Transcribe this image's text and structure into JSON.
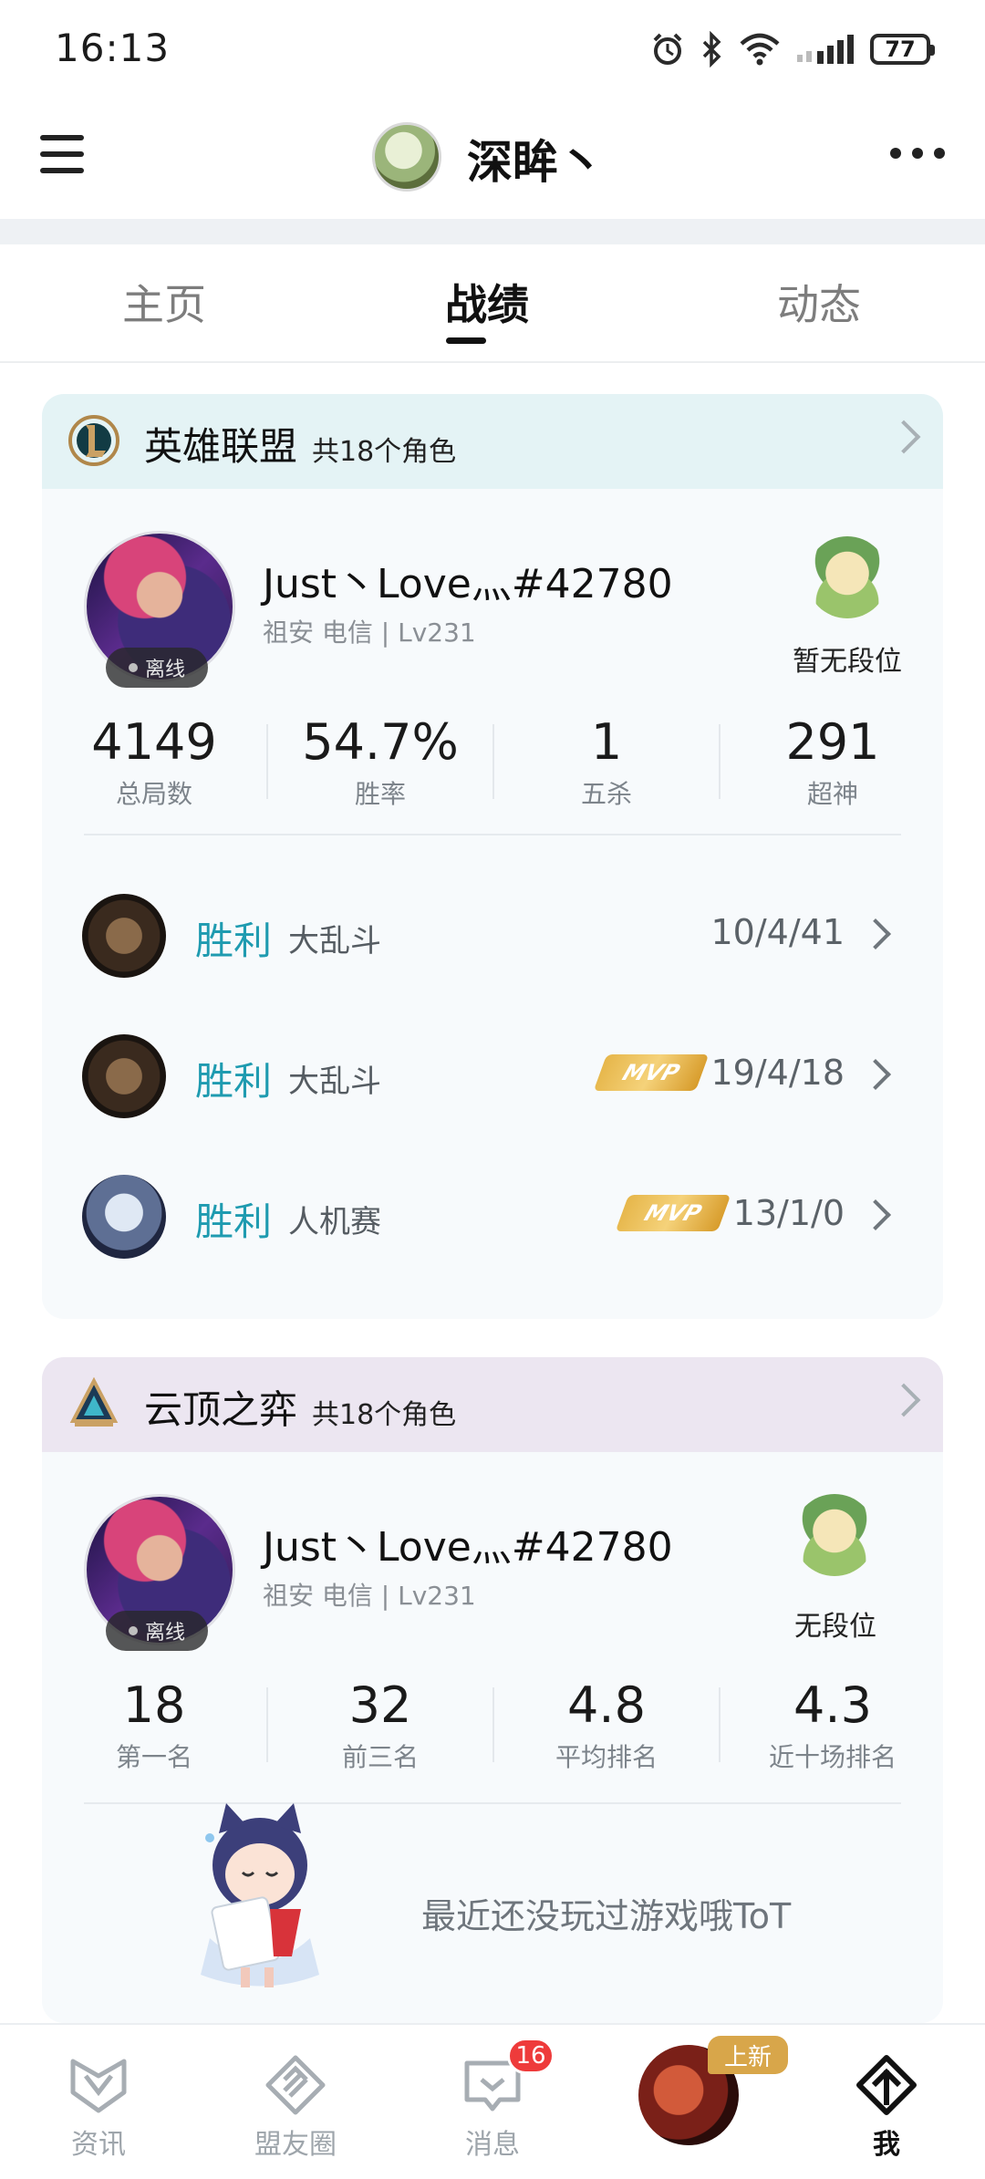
{
  "status_bar": {
    "time": "16:13",
    "battery": "77",
    "icons": [
      "alarm-icon",
      "bluetooth-icon",
      "wifi-icon",
      "signal-icon",
      "battery-icon"
    ]
  },
  "header": {
    "title": "深眸丶",
    "menu_icon": "menu-icon",
    "more_icon": "more-icon"
  },
  "tabs": [
    {
      "label": "主页",
      "active": false
    },
    {
      "label": "战绩",
      "active": true
    },
    {
      "label": "动态",
      "active": false
    }
  ],
  "lol_card": {
    "title": "英雄联盟",
    "count": "共18个角色",
    "account_name": "Just丶Love灬#42780",
    "account_meta": "祖安 电信 | Lv231",
    "status": "离线",
    "rank_label": "暂无段位",
    "stats": [
      {
        "value": "4149",
        "label": "总局数"
      },
      {
        "value": "54.7%",
        "label": "胜率"
      },
      {
        "value": "1",
        "label": "五杀"
      },
      {
        "value": "291",
        "label": "超神"
      }
    ],
    "matches": [
      {
        "result": "胜利",
        "mode": "大乱斗",
        "mvp": false,
        "kda": "10/4/41"
      },
      {
        "result": "胜利",
        "mode": "大乱斗",
        "mvp": true,
        "kda": "19/4/18"
      },
      {
        "result": "胜利",
        "mode": "人机赛",
        "mvp": true,
        "kda": "13/1/0"
      }
    ],
    "mvp_label": "MVP"
  },
  "tft_card": {
    "title": "云顶之弈",
    "count": "共18个角色",
    "account_name": "Just丶Love灬#42780",
    "account_meta": "祖安 电信 | Lv231",
    "status": "离线",
    "rank_label": "无段位",
    "stats": [
      {
        "value": "18",
        "label": "第一名"
      },
      {
        "value": "32",
        "label": "前三名"
      },
      {
        "value": "4.8",
        "label": "平均排名"
      },
      {
        "value": "4.3",
        "label": "近十场排名"
      }
    ],
    "empty_text": "最近还没玩过游戏哦ToT"
  },
  "bottom_nav": [
    {
      "label": "资讯",
      "icon": "news-icon"
    },
    {
      "label": "盟友圈",
      "icon": "community-icon"
    },
    {
      "label": "消息",
      "icon": "message-icon",
      "badge": "16"
    },
    {
      "label": "",
      "icon": "game-avatar",
      "tag": "上新"
    },
    {
      "label": "我",
      "icon": "profile-icon",
      "active": true
    }
  ],
  "colors": {
    "win": "#1f9bb0",
    "lol_header": "#e4f3f5",
    "tft_header": "#ece6f1",
    "badge": "#ee3b3b",
    "mvp_gold": "#e6b64a"
  }
}
